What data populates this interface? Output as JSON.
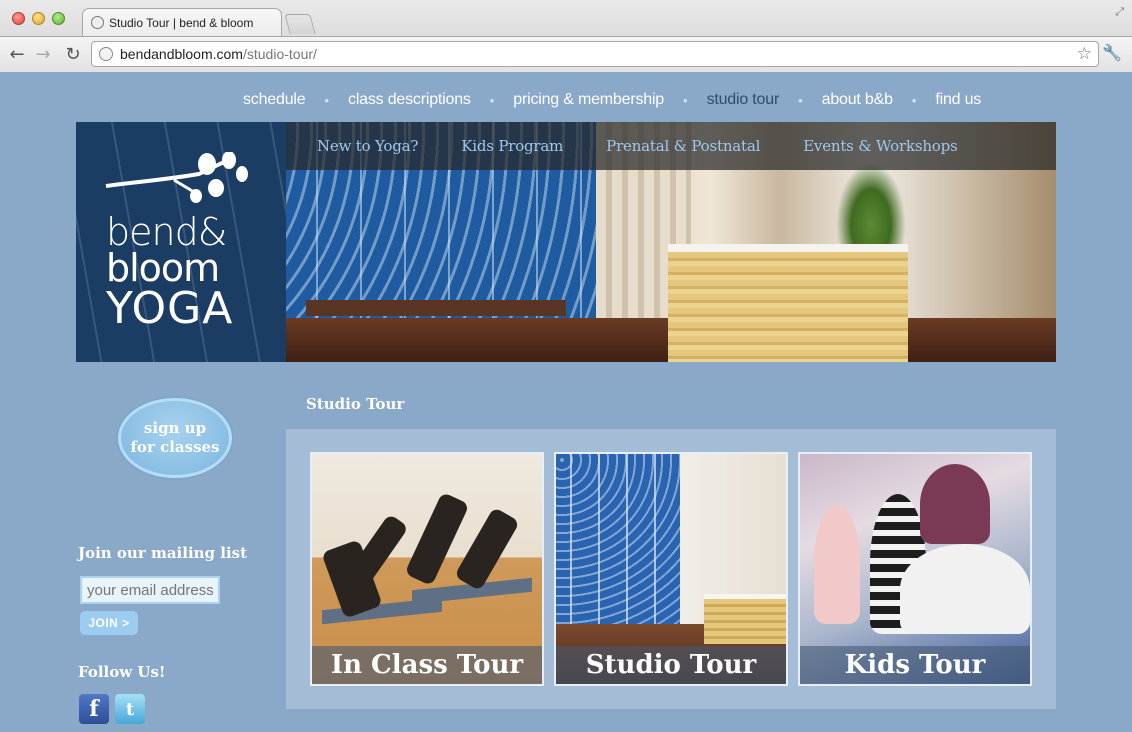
{
  "browser": {
    "tab_title": "Studio Tour | bend & bloom",
    "url_host": "bendandbloom.com",
    "url_path": "/studio-tour/"
  },
  "topnav": [
    {
      "label": "schedule",
      "active": false
    },
    {
      "label": "class descriptions",
      "active": false
    },
    {
      "label": "pricing & membership",
      "active": false
    },
    {
      "label": "studio tour",
      "active": true
    },
    {
      "label": "about b&b",
      "active": false
    },
    {
      "label": "find us",
      "active": false
    }
  ],
  "hero_menu": [
    "New to Yoga?",
    "Kids Program",
    "Prenatal & Postnatal",
    "Events & Workshops"
  ],
  "logo": {
    "line1": "bend&",
    "line2": "bloom",
    "line3": "YOGA"
  },
  "sidebar": {
    "signup_line1": "sign up",
    "signup_line2": "for classes",
    "mailing_title": "Join our mailing list",
    "email_placeholder": "your email address",
    "join_label": "JOIN >",
    "follow_title": "Follow Us!",
    "facebook_glyph": "f",
    "twitter_glyph": "t"
  },
  "main": {
    "section_title": "Studio Tour",
    "cards": [
      {
        "caption": "In Class Tour"
      },
      {
        "caption": "Studio Tour"
      },
      {
        "caption": "Kids Tour"
      }
    ]
  },
  "colors": {
    "page_bg": "#8aa8c8",
    "active_nav": "#2e4d6e",
    "hero_menu_text": "#9ec8ee",
    "gallery_bg": "#a4bcd6"
  }
}
